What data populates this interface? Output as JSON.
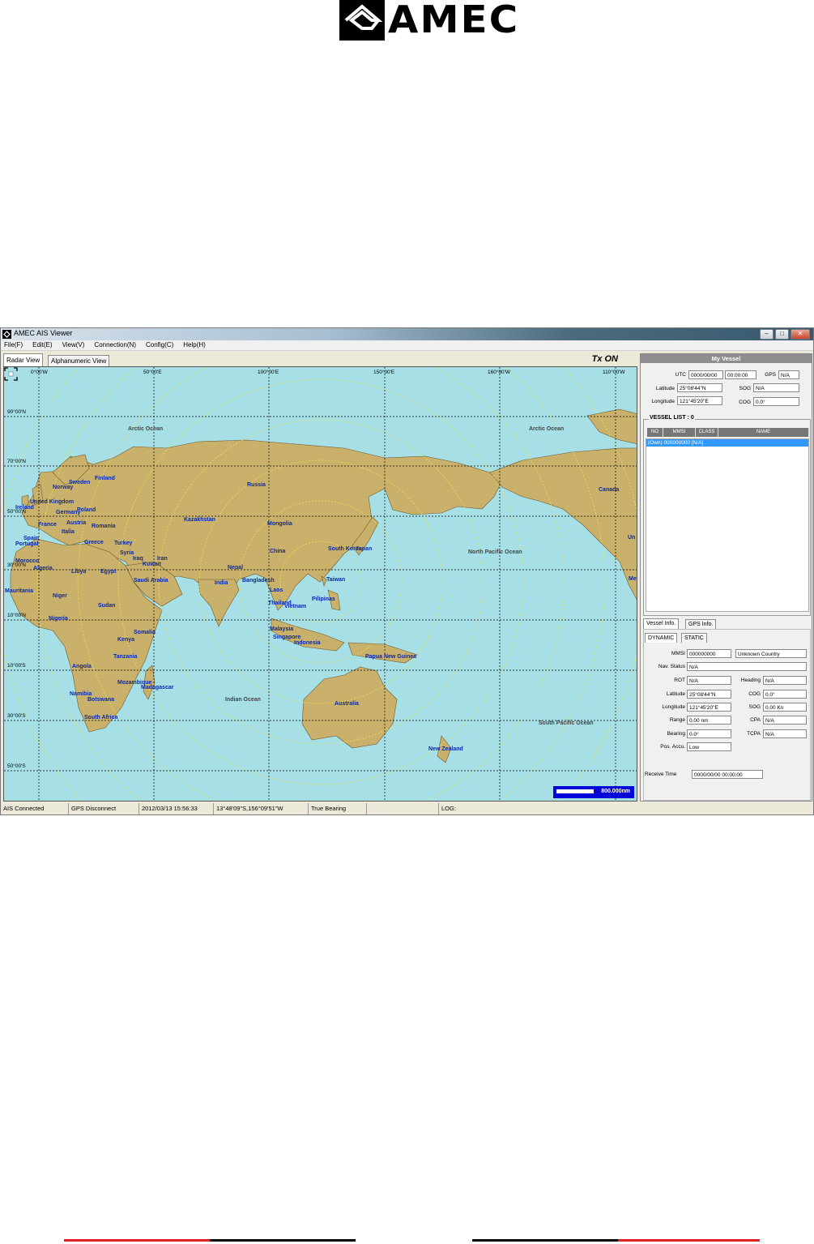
{
  "brand": {
    "logo_text": "AMEC"
  },
  "window": {
    "title": "AMEC AIS Viewer"
  },
  "menu": [
    "File(F)",
    "Edit(E)",
    "View(V)",
    "Connection(N)",
    "Config(C)",
    "Help(H)"
  ],
  "tabs": {
    "radar": "Radar View",
    "alpha": "Alphanumeric View",
    "tx_status": "Tx ON"
  },
  "map": {
    "lon_labels": [
      "0°00'W",
      "50°00'E",
      "100°00'E",
      "150°00'E",
      "160°00'W",
      "110°00'W"
    ],
    "lat_labels": [
      "90°00'N",
      "70°00'N",
      "50°00'N",
      "30°00'N",
      "10°00'N",
      "10°00'S",
      "30°00'S",
      "50°00'S"
    ],
    "oceans": [
      "Arctic Ocean",
      "Arctic Ocean",
      "North Pacific Ocean",
      "Indian Ocean",
      "South Pacific Ocean"
    ],
    "countries": [
      "Sweden",
      "Finland",
      "Norway",
      "Russia",
      "Ireland",
      "United Kingdom",
      "Germany",
      "Poland",
      "Canada",
      "Kazakhstan",
      "Mongolia",
      "France",
      "Austria",
      "Romania",
      "Italia",
      "Spain",
      "Portugal",
      "Greece",
      "Turkey",
      "Syria",
      "China",
      "South Korea",
      "Japan",
      "Morocco",
      "Iraq",
      "Kuwait",
      "Iran",
      "Algeria",
      "Libya",
      "Egypt",
      "Nepal",
      "Saudi Arabia",
      "Bangladesh",
      "India",
      "Taiwan",
      "Mauritania",
      "Laos",
      "Niger",
      "Thailand",
      "Vietnam",
      "Sudan",
      "Pilipinas",
      "Nigeria",
      "Somalia",
      "Malaysia",
      "Kenya",
      "Singapore",
      "Indonesia",
      "Papua New Guinea",
      "Tanzania",
      "Angola",
      "Mozambique",
      "Madagascar",
      "Namibia",
      "Botswana",
      "Australia",
      "South Africa",
      "New Zealand",
      "Un",
      "Me"
    ],
    "scale": "800.000nm"
  },
  "my_vessel": {
    "header": "My Vessel",
    "utc_label": "UTC",
    "utc_date": "0000/00/00",
    "utc_time": "00:00:00",
    "gps_label": "GPS",
    "gps_value": "N/A",
    "lat_label": "Latitude",
    "lat_value": "25°08'44\"N",
    "sog_label": "SOG",
    "sog_value": "N/A",
    "lon_label": "Longitude",
    "lon_value": "121°45'20\"E",
    "cog_label": "COG",
    "cog_value": "0.0°"
  },
  "vessel_list": {
    "title": "VESSEL LIST : 0",
    "columns": [
      "NO",
      "MMSI",
      "CLASS",
      "NAME"
    ],
    "rows": [
      "(Own) 000000000 [N/A]"
    ]
  },
  "info_tabs": {
    "vessel": "Vessel Info.",
    "gps": "GPS Info.",
    "dynamic": "DYNAMIC",
    "static": "STATIC"
  },
  "vessel_info": {
    "mmsi_label": "MMSI",
    "mmsi_value": "000000000",
    "country": "Unknown Country",
    "nav_label": "Nav. Status",
    "nav_value": "N/A",
    "rot_label": "ROT",
    "rot_value": "N/A",
    "heading_label": "Heading",
    "heading_value": "N/A",
    "lat_label": "Latitude",
    "lat_value": "25°08'44\"N",
    "cog_label": "COG",
    "cog_value": "0.0°",
    "lon_label": "Longitude",
    "lon_value": "121°45'20\"E",
    "sog_label": "SOG",
    "sog_value": "0.00 Kn",
    "range_label": "Range",
    "range_value": "0.00 nm",
    "cpa_label": "CPA",
    "cpa_value": "N/A",
    "bearing_label": "Bearing",
    "bearing_value": "0.0°",
    "tcpa_label": "TCPA",
    "tcpa_value": "N/A",
    "posaccu_label": "Pos. Accu.",
    "posaccu_value": "Low",
    "receive_label": "Receive Time",
    "receive_value": "0000/00/00 00:00:00"
  },
  "status": {
    "ais": "AIS Connected",
    "gps": "GPS Disconnect",
    "datetime": "2012/03/13 15:56:33",
    "cursor": "13°48'09\"S,156°09'51\"W",
    "bearing": "True Bearing",
    "blank": "",
    "log": "LOG:"
  },
  "colors": {
    "land": "#c9b06b",
    "sea": "#a6dfe6",
    "footer_red": "#e02020",
    "footer_black": "#000000"
  }
}
